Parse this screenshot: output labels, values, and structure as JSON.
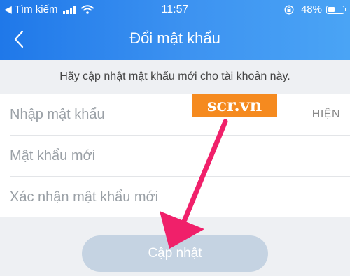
{
  "status_bar": {
    "back_app_label": "Tìm kiếm",
    "time": "11:57",
    "battery_percent": "48%",
    "battery_level": 0.48,
    "icons": [
      "back-arrow-icon",
      "signal-icon",
      "wifi-icon",
      "rotation-lock-icon",
      "battery-icon"
    ]
  },
  "header": {
    "title": "Đổi mật khẩu",
    "back_icon": "chevron-left-icon"
  },
  "hint": "Hãy cập nhật mật khẩu mới cho tài khoản này.",
  "form": {
    "current_password_placeholder": "Nhập mật khẩu",
    "show_label": "HIỆN",
    "new_password_placeholder": "Mật khẩu mới",
    "confirm_password_placeholder": "Xác nhận mật khẩu mới"
  },
  "submit_label": "Cập nhật",
  "watermark": "scr.vn",
  "colors": {
    "header_start": "#1f78e9",
    "header_end": "#4aa4f5",
    "button_disabled": "#c5d3e2",
    "watermark_bg": "#f58a1f",
    "arrow": "#f0206a"
  }
}
